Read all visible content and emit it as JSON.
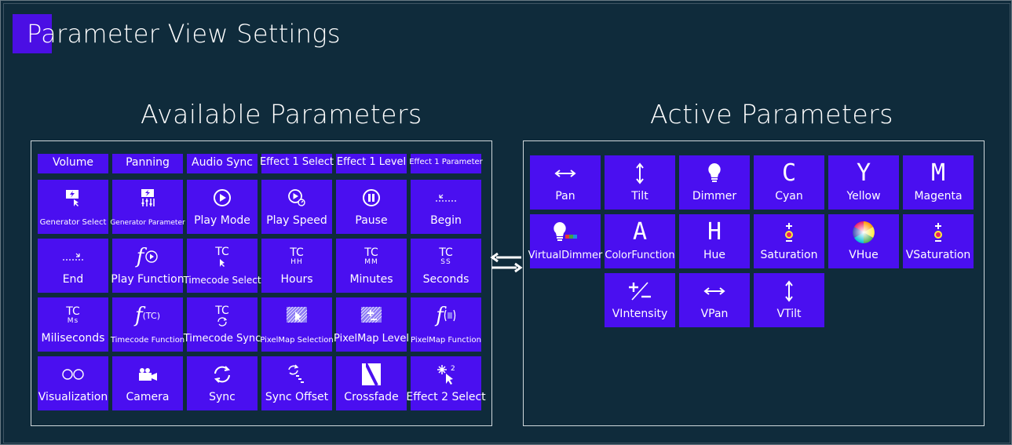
{
  "window": {
    "title": "Parameter View Settings"
  },
  "available": {
    "heading": "Available Parameters",
    "tiles": [
      {
        "label": "Volume",
        "icon": "none"
      },
      {
        "label": "Panning",
        "icon": "none"
      },
      {
        "label": "Audio Sync",
        "icon": "none"
      },
      {
        "label": "Effect 1 Select",
        "icon": "none"
      },
      {
        "label": "Effect 1 Level",
        "icon": "none"
      },
      {
        "label": "Effect 1 Parameter",
        "icon": "none"
      },
      {
        "label": "Generator Select",
        "icon": "generator-select-icon"
      },
      {
        "label": "Generator Parameter",
        "icon": "generator-parameter-icon"
      },
      {
        "label": "Play Mode",
        "icon": "play-circle-icon"
      },
      {
        "label": "Play Speed",
        "icon": "play-speed-icon"
      },
      {
        "label": "Pause",
        "icon": "pause-circle-icon"
      },
      {
        "label": "Begin",
        "icon": "begin-icon"
      },
      {
        "label": "End",
        "icon": "end-icon"
      },
      {
        "label": "Play Function",
        "icon": "play-function-icon"
      },
      {
        "label": "Timecode Select",
        "icon": "timecode-select-icon"
      },
      {
        "label": "Hours",
        "icon": "timecode-hours-icon"
      },
      {
        "label": "Minutes",
        "icon": "timecode-minutes-icon"
      },
      {
        "label": "Seconds",
        "icon": "timecode-seconds-icon"
      },
      {
        "label": "Miliseconds",
        "icon": "timecode-ms-icon"
      },
      {
        "label": "Timecode Function",
        "icon": "timecode-function-icon"
      },
      {
        "label": "Timecode Sync",
        "icon": "timecode-sync-icon"
      },
      {
        "label": "PixelMap Selection",
        "icon": "pixelmap-selection-icon"
      },
      {
        "label": "PixelMap Level",
        "icon": "pixelmap-level-icon"
      },
      {
        "label": "PixelMap Function",
        "icon": "pixelmap-function-icon"
      },
      {
        "label": "Visualization",
        "icon": "visualization-icon"
      },
      {
        "label": "Camera",
        "icon": "camera-icon"
      },
      {
        "label": "Sync",
        "icon": "sync-icon"
      },
      {
        "label": "Sync Offset",
        "icon": "sync-offset-icon"
      },
      {
        "label": "Crossfade",
        "icon": "crossfade-icon"
      },
      {
        "label": "Effect 2 Select",
        "icon": "effect-2-select-icon"
      }
    ],
    "timecode": {
      "tc": "TC",
      "hh": "HH",
      "mm": "MM",
      "ss": "SS",
      "ms": "Ms",
      "plain": "TC"
    }
  },
  "active": {
    "heading": "Active Parameters",
    "tiles": [
      {
        "label": "Pan",
        "icon": "horizontal-arrows-icon"
      },
      {
        "label": "Tilt",
        "icon": "vertical-arrows-icon"
      },
      {
        "label": "Dimmer",
        "icon": "lightbulb-icon"
      },
      {
        "label": "Cyan",
        "icon": "letter-c-icon",
        "glyph": "C"
      },
      {
        "label": "Yellow",
        "icon": "letter-y-icon",
        "glyph": "Y"
      },
      {
        "label": "Magenta",
        "icon": "letter-m-icon",
        "glyph": "M"
      },
      {
        "label": "VirtualDimmer",
        "icon": "virtual-dimmer-icon"
      },
      {
        "label": "ColorFunction",
        "icon": "letter-a-icon",
        "glyph": "A"
      },
      {
        "label": "Hue",
        "icon": "letter-h-icon",
        "glyph": "H"
      },
      {
        "label": "Saturation",
        "icon": "saturation-icon"
      },
      {
        "label": "VHue",
        "icon": "color-wheel-icon"
      },
      {
        "label": "VSaturation",
        "icon": "saturation-icon"
      },
      {
        "label": "VIntensity",
        "icon": "plus-minus-icon"
      },
      {
        "label": "VPan",
        "icon": "horizontal-arrows-icon"
      },
      {
        "label": "VTilt",
        "icon": "vertical-arrows-icon"
      }
    ]
  },
  "colors": {
    "background": "#0f2b3b",
    "tile": "#4a0ff0",
    "accent": "#4b0fe4",
    "panel_border": "#cfd8dc"
  }
}
